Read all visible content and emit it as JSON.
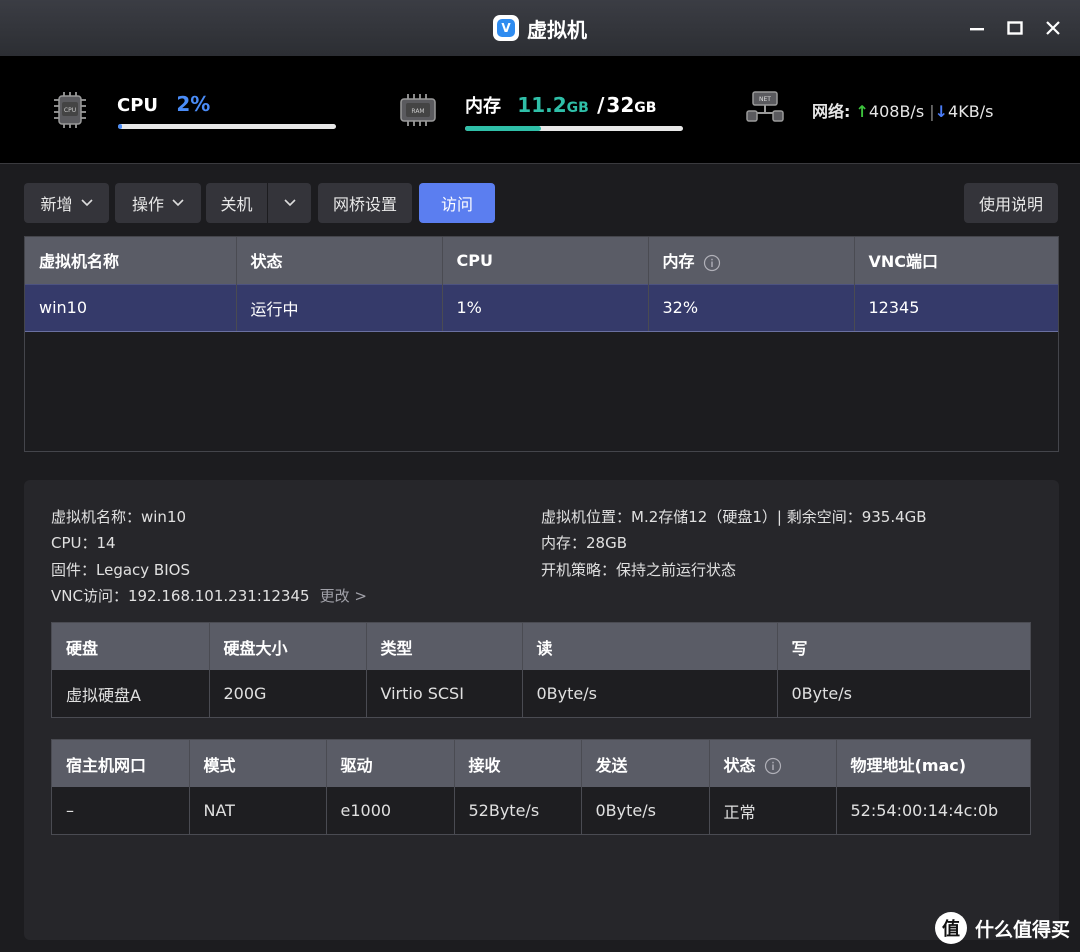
{
  "window": {
    "title": "虚拟机",
    "logo_letter": "V"
  },
  "stats": {
    "cpu": {
      "chip_text": "CPU",
      "label": "CPU",
      "value": "2%",
      "usage_fraction": 0.02,
      "color": "#4a8cf7"
    },
    "memory": {
      "chip_text": "RAM",
      "label": "内存",
      "used_num": "11.2",
      "used_unit": "GB",
      "sep": "/",
      "total_num": "32",
      "total_unit": "GB",
      "usage_fraction": 0.35,
      "color": "#2fbfa8"
    },
    "network": {
      "chip_text": "NET",
      "label": "网络:",
      "up_arrow": "↑",
      "up": "408B/s",
      "divider": "|",
      "down_arrow": "↓",
      "down": "4KB/s",
      "up_color": "#3cc23c",
      "down_color": "#4a7cf7"
    }
  },
  "toolbar": {
    "add_label": "新增",
    "ops_label": "操作",
    "shutdown_label": "关机",
    "bridge_label": "网桥设置",
    "visit_label": "访问",
    "help_label": "使用说明"
  },
  "vm_table": {
    "headers": [
      "虚拟机名称",
      "状态",
      "CPU",
      "内存",
      "VNC端口"
    ],
    "rows": [
      [
        "win10",
        "运行中",
        "1%",
        "32%",
        "12345"
      ]
    ]
  },
  "details": {
    "name": "虚拟机名称：win10",
    "cpu": "CPU：14",
    "firmware": "固件：Legacy BIOS",
    "vnc": "VNC访问：192.168.101.231:12345",
    "vnc_change": "更改 >",
    "location": "虚拟机位置：M.2存储12（硬盘1）| 剩余空间：935.4GB",
    "memory": "内存：28GB",
    "boot_policy": "开机策略：保持之前运行状态"
  },
  "disk_table": {
    "headers": [
      "硬盘",
      "硬盘大小",
      "类型",
      "读",
      "写"
    ],
    "rows": [
      [
        "虚拟硬盘A",
        "200G",
        "Virtio SCSI",
        "0Byte/s",
        "0Byte/s"
      ]
    ]
  },
  "net_table": {
    "headers": [
      "宿主机网口",
      "模式",
      "驱动",
      "接收",
      "发送",
      "状态",
      "物理地址(mac)"
    ],
    "rows": [
      [
        "–",
        "NAT",
        "e1000",
        "52Byte/s",
        "0Byte/s",
        "正常",
        "52:54:00:14:4c:0b"
      ]
    ]
  },
  "watermark": {
    "logo_text": "值",
    "text": "什么值得买"
  }
}
